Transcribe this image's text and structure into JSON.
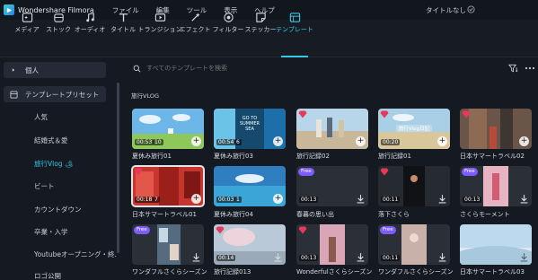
{
  "app": {
    "name": "Wondershare Filmora",
    "project": "タイトルなし"
  },
  "menus": [
    "ファイル",
    "編集",
    "ツール",
    "表示",
    "ヘルプ"
  ],
  "toolbar": [
    {
      "label": "メディア",
      "icon": "media-icon"
    },
    {
      "label": "ストック",
      "icon": "stock-icon"
    },
    {
      "label": "オーディオ",
      "icon": "audio-icon"
    },
    {
      "label": "タイトル",
      "icon": "title-icon"
    },
    {
      "label": "トランジション",
      "icon": "transition-icon"
    },
    {
      "label": "エフェクト",
      "icon": "effect-icon"
    },
    {
      "label": "フィルター",
      "icon": "filter-icon"
    },
    {
      "label": "ステッカー",
      "icon": "sticker-icon"
    },
    {
      "label": "テンプレート",
      "icon": "template-icon",
      "active": true
    }
  ],
  "sidebar": {
    "personal": "個人",
    "preset": "テンプレートプリセット",
    "items": [
      "人気",
      "結婚式＆愛",
      "旅行Vlog 🏕",
      "ビート",
      "カウントダウン",
      "卒業・入学",
      "Youtubeオープニング・終...",
      "ロゴ公開"
    ],
    "active_index": 2
  },
  "search": {
    "placeholder": "すべてのテンプレートを検索"
  },
  "section_title": "旅行VLOG",
  "colors": {
    "accent": "#35c9e8",
    "free_badge": "#7c5cff",
    "gem_badge": "#e8385a"
  },
  "cards": [
    {
      "label": "夏休み旅行01",
      "badge": "none",
      "duration": "00:53",
      "clips": "10",
      "action": "add"
    },
    {
      "label": "夏休み旅行03",
      "badge": "none",
      "duration": "00:54",
      "clips": "6",
      "action": "add"
    },
    {
      "label": "旅行記録02",
      "badge": "gem",
      "duration": "",
      "clips": "",
      "action": "add"
    },
    {
      "label": "旅行記録01",
      "badge": "gem",
      "duration": "00:20",
      "clips": "",
      "action": "add"
    },
    {
      "label": "日本サマートラベル02",
      "badge": "gem",
      "duration": "",
      "clips": "",
      "action": "add"
    },
    {
      "label": "日本サマートラベル01",
      "badge": "gem",
      "duration": "00:18",
      "clips": "7",
      "action": "add"
    },
    {
      "label": "夏休み旅行04",
      "badge": "none",
      "duration": "00:03",
      "clips": "1",
      "action": "add"
    },
    {
      "label": "春暮の思い出",
      "badge": "free",
      "duration": "00:13",
      "clips": "",
      "action": "download"
    },
    {
      "label": "落下さくら",
      "badge": "gem",
      "duration": "00:11",
      "clips": "",
      "action": "download"
    },
    {
      "label": "さくらモーメント",
      "badge": "free",
      "duration": "00:13",
      "clips": "",
      "action": "download"
    },
    {
      "label": "ワンダフルさくらシーズン07",
      "badge": "free",
      "duration": "",
      "clips": "",
      "action": "download"
    },
    {
      "label": "旅行記録013",
      "badge": "gem",
      "duration": "00:14",
      "clips": "",
      "action": "download"
    },
    {
      "label": "Wonderfulさくらシーズン01",
      "badge": "gem",
      "duration": "00:13",
      "clips": "",
      "action": "download"
    },
    {
      "label": "ワンダフルさくらシーズン10",
      "badge": "free",
      "duration": "00:11",
      "clips": "",
      "action": "download"
    },
    {
      "label": "日本サマートラベル03",
      "badge": "none",
      "duration": "",
      "clips": "",
      "action": "download"
    }
  ],
  "card_overlays": {
    "summer_sea": "GO TO SUMMER SEA",
    "travel_vlog": "旅行Vlog日記"
  },
  "free_label": "Free"
}
